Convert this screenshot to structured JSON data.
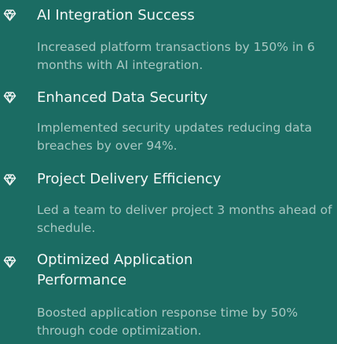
{
  "colors": {
    "background": "#1b6c63",
    "title": "#f4f7f6",
    "description": "#a9c8c3",
    "icon": "#f2f5f4"
  },
  "achievements": [
    {
      "icon": "gem-icon",
      "title": "AI Integration Success",
      "description": "Increased platform transactions by 150% in 6 months with AI integration."
    },
    {
      "icon": "gem-icon",
      "title": "Enhanced Data Security",
      "description": "Implemented security updates reducing data breaches by over 94%."
    },
    {
      "icon": "gem-icon",
      "title": "Project Delivery Efficiency",
      "description": "Led a team to deliver project 3 months ahead of schedule."
    },
    {
      "icon": "gem-icon",
      "title": "Optimized Application Performance",
      "description": "Boosted application response time by 50% through code optimization."
    }
  ]
}
